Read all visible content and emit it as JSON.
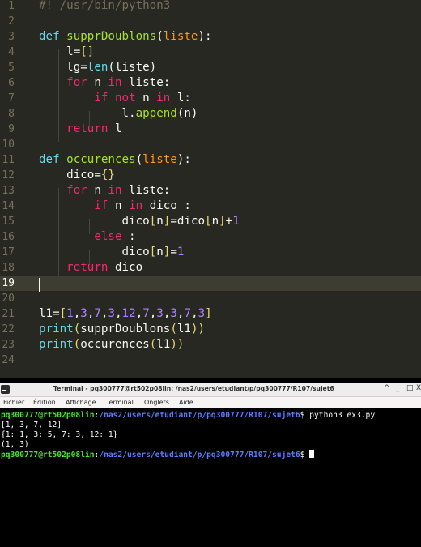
{
  "editor": {
    "lines": [
      {
        "n": "1",
        "tokens": [
          {
            "t": "#! /usr/bin/python3",
            "c": "cm"
          }
        ]
      },
      {
        "n": "2",
        "tokens": []
      },
      {
        "n": "3",
        "tokens": [
          {
            "t": "def ",
            "c": "bi"
          },
          {
            "t": "supprDoublons",
            "c": "fn"
          },
          {
            "t": "(",
            "c": ""
          },
          {
            "t": "liste",
            "c": "pa"
          },
          {
            "t": "):",
            "c": ""
          }
        ]
      },
      {
        "n": "4",
        "tokens": [
          {
            "t": "    l=",
            "c": ""
          },
          {
            "t": "[]",
            "c": "br"
          }
        ]
      },
      {
        "n": "5",
        "tokens": [
          {
            "t": "    lg=",
            "c": ""
          },
          {
            "t": "len",
            "c": "bi"
          },
          {
            "t": "(liste)",
            "c": ""
          }
        ]
      },
      {
        "n": "6",
        "tokens": [
          {
            "t": "    ",
            "c": ""
          },
          {
            "t": "for",
            "c": "kw"
          },
          {
            "t": " n ",
            "c": ""
          },
          {
            "t": "in",
            "c": "kw"
          },
          {
            "t": " liste:",
            "c": ""
          }
        ]
      },
      {
        "n": "7",
        "tokens": [
          {
            "t": "        ",
            "c": ""
          },
          {
            "t": "if",
            "c": "kw"
          },
          {
            "t": " ",
            "c": ""
          },
          {
            "t": "not",
            "c": "kw"
          },
          {
            "t": " n ",
            "c": ""
          },
          {
            "t": "in",
            "c": "kw"
          },
          {
            "t": " l:",
            "c": ""
          }
        ]
      },
      {
        "n": "8",
        "tokens": [
          {
            "t": "            l.",
            "c": ""
          },
          {
            "t": "append",
            "c": "fn"
          },
          {
            "t": "(n)",
            "c": ""
          }
        ]
      },
      {
        "n": "9",
        "tokens": [
          {
            "t": "    ",
            "c": ""
          },
          {
            "t": "return",
            "c": "kw"
          },
          {
            "t": " l",
            "c": ""
          }
        ]
      },
      {
        "n": "10",
        "tokens": []
      },
      {
        "n": "11",
        "tokens": [
          {
            "t": "def ",
            "c": "bi"
          },
          {
            "t": "occurences",
            "c": "fn"
          },
          {
            "t": "(",
            "c": ""
          },
          {
            "t": "liste",
            "c": "pa"
          },
          {
            "t": "):",
            "c": ""
          }
        ]
      },
      {
        "n": "12",
        "tokens": [
          {
            "t": "    dico=",
            "c": ""
          },
          {
            "t": "{}",
            "c": "br"
          }
        ]
      },
      {
        "n": "13",
        "tokens": [
          {
            "t": "    ",
            "c": ""
          },
          {
            "t": "for",
            "c": "kw"
          },
          {
            "t": " n ",
            "c": ""
          },
          {
            "t": "in",
            "c": "kw"
          },
          {
            "t": " liste:",
            "c": ""
          }
        ]
      },
      {
        "n": "14",
        "tokens": [
          {
            "t": "        ",
            "c": ""
          },
          {
            "t": "if",
            "c": "kw"
          },
          {
            "t": " n ",
            "c": ""
          },
          {
            "t": "in",
            "c": "kw"
          },
          {
            "t": " dico :",
            "c": ""
          }
        ]
      },
      {
        "n": "15",
        "tokens": [
          {
            "t": "            dico",
            "c": ""
          },
          {
            "t": "[",
            "c": "br"
          },
          {
            "t": "n",
            "c": ""
          },
          {
            "t": "]",
            "c": "br"
          },
          {
            "t": "=dico",
            "c": ""
          },
          {
            "t": "[",
            "c": "br"
          },
          {
            "t": "n",
            "c": ""
          },
          {
            "t": "]",
            "c": "br"
          },
          {
            "t": "+",
            "c": ""
          },
          {
            "t": "1",
            "c": "nu"
          }
        ]
      },
      {
        "n": "16",
        "tokens": [
          {
            "t": "        ",
            "c": ""
          },
          {
            "t": "else",
            "c": "kw"
          },
          {
            "t": " :",
            "c": ""
          }
        ]
      },
      {
        "n": "17",
        "tokens": [
          {
            "t": "            dico",
            "c": ""
          },
          {
            "t": "[",
            "c": "br"
          },
          {
            "t": "n",
            "c": ""
          },
          {
            "t": "]",
            "c": "br"
          },
          {
            "t": "=",
            "c": ""
          },
          {
            "t": "1",
            "c": "nu"
          }
        ]
      },
      {
        "n": "18",
        "tokens": [
          {
            "t": "    ",
            "c": ""
          },
          {
            "t": "return",
            "c": "kw"
          },
          {
            "t": " dico",
            "c": ""
          }
        ]
      },
      {
        "n": "19",
        "tokens": []
      },
      {
        "n": "20",
        "tokens": []
      },
      {
        "n": "21",
        "tokens": [
          {
            "t": "l1=",
            "c": ""
          },
          {
            "t": "[",
            "c": "br"
          },
          {
            "t": "1",
            "c": "nu"
          },
          {
            "t": ",",
            "c": ""
          },
          {
            "t": "3",
            "c": "nu"
          },
          {
            "t": ",",
            "c": ""
          },
          {
            "t": "7",
            "c": "nu"
          },
          {
            "t": ",",
            "c": ""
          },
          {
            "t": "3",
            "c": "nu"
          },
          {
            "t": ",",
            "c": ""
          },
          {
            "t": "12",
            "c": "nu"
          },
          {
            "t": ",",
            "c": ""
          },
          {
            "t": "7",
            "c": "nu"
          },
          {
            "t": ",",
            "c": ""
          },
          {
            "t": "3",
            "c": "nu"
          },
          {
            "t": ",",
            "c": ""
          },
          {
            "t": "3",
            "c": "nu"
          },
          {
            "t": ",",
            "c": ""
          },
          {
            "t": "7",
            "c": "nu"
          },
          {
            "t": ",",
            "c": ""
          },
          {
            "t": "3",
            "c": "nu"
          },
          {
            "t": "]",
            "c": "br"
          }
        ]
      },
      {
        "n": "22",
        "tokens": [
          {
            "t": "print",
            "c": "bi"
          },
          {
            "t": "(",
            "c": "br"
          },
          {
            "t": "supprDoublons",
            "c": ""
          },
          {
            "t": "(",
            "c": "br"
          },
          {
            "t": "l1",
            "c": ""
          },
          {
            "t": "))",
            "c": "br"
          }
        ]
      },
      {
        "n": "23",
        "tokens": [
          {
            "t": "print",
            "c": "bi"
          },
          {
            "t": "(",
            "c": "br"
          },
          {
            "t": "occurences",
            "c": ""
          },
          {
            "t": "(",
            "c": "br"
          },
          {
            "t": "l1",
            "c": ""
          },
          {
            "t": "))",
            "c": "br"
          }
        ]
      },
      {
        "n": "24",
        "tokens": []
      }
    ]
  },
  "terminal": {
    "title": "Terminal - pq300777@rt502p08lin: /nas2/users/etudiant/p/pq300777/R107/sujet6",
    "window_buttons": {
      "up": "^",
      "minimize": "_",
      "maximize": "□",
      "close": "X"
    },
    "menus": [
      "Fichier",
      "Édition",
      "Affichage",
      "Terminal",
      "Onglets",
      "Aide"
    ],
    "prompt_user": "pq300777@rt502p08lin",
    "prompt_sep": ":",
    "prompt_path": "/nas2/users/etudiant/p/pq300777/R107/sujet6",
    "prompt_end": "$ ",
    "command": "python3 ex3.py",
    "output": [
      "[1, 3, 7, 12]",
      "{1: 1, 3: 5, 7: 3, 12: 1}",
      "(1, 3)"
    ]
  },
  "colors": {
    "editor_bg": "#272822",
    "keyword": "#f92672",
    "function": "#a6e22e",
    "builtin": "#66d9ef",
    "param": "#fd971f",
    "number": "#ae81ff",
    "prompt_user": "#4be12f",
    "prompt_path": "#5b7cff"
  }
}
